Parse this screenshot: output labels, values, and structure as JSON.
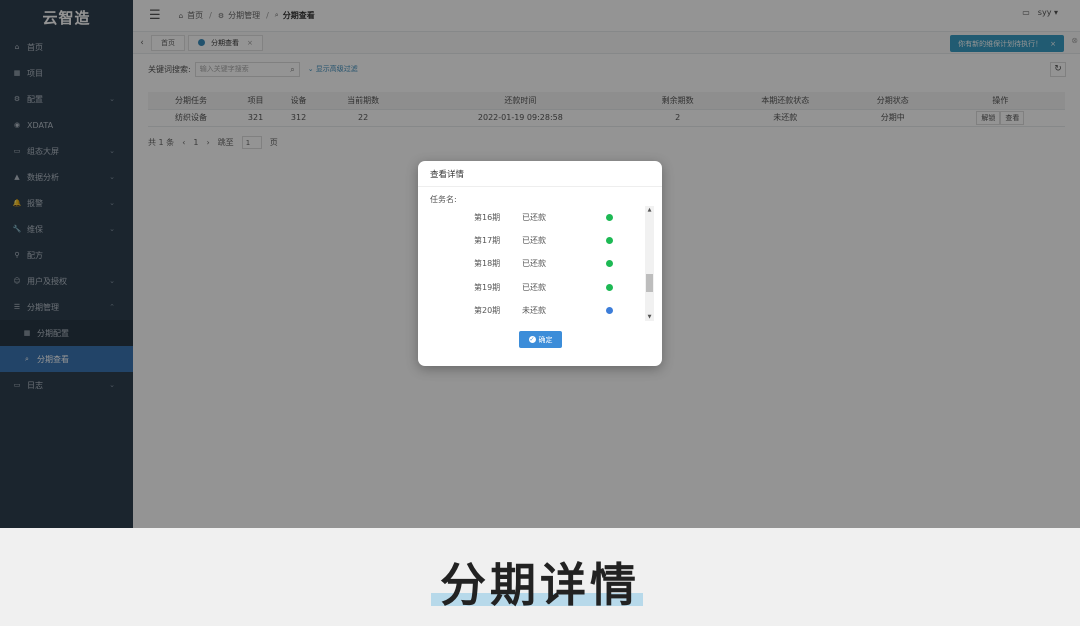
{
  "app": {
    "logo": "云智造"
  },
  "sidebar": {
    "items": [
      {
        "icon": "⌂",
        "label": "首页"
      },
      {
        "icon": "▦",
        "label": "项目"
      },
      {
        "icon": "⚙",
        "label": "配置",
        "chev": "⌄"
      },
      {
        "icon": "◉",
        "label": "XDATA"
      },
      {
        "icon": "▭",
        "label": "组态大屏",
        "chev": "⌄"
      },
      {
        "icon": "▲",
        "label": "数据分析",
        "chev": "⌄"
      },
      {
        "icon": "🔔",
        "label": "报警",
        "chev": "⌄"
      },
      {
        "icon": "🔧",
        "label": "维保",
        "chev": "⌄"
      },
      {
        "icon": "⚲",
        "label": "配方"
      },
      {
        "icon": "☺",
        "label": "用户及授权",
        "chev": "⌄"
      },
      {
        "icon": "☰",
        "label": "分期管理",
        "chev": "⌃"
      },
      {
        "icon": "▦",
        "label": "分期配置"
      },
      {
        "icon": "⌕",
        "label": "分期查看"
      },
      {
        "icon": "▭",
        "label": "日志",
        "chev": "⌄"
      }
    ]
  },
  "topbar": {
    "hamburger": "☰",
    "crumb_home_icon": "⌂",
    "crumb_home": "首页",
    "crumb_mid_icon": "⚙",
    "crumb_mid": "分期管理",
    "crumb_cur_icon": "⌕",
    "crumb_cur": "分期查看",
    "msg_icon": "▭",
    "user": "syy ▾"
  },
  "tabs": {
    "prev": "‹",
    "items": [
      {
        "label": "首页"
      },
      {
        "label": "分期查看",
        "close": "×"
      }
    ]
  },
  "notice": {
    "text": "你有新的维保计划待执行！",
    "close": "×",
    "close_outer": "⊗"
  },
  "toolbar": {
    "search_label": "关键词搜索:",
    "search_placeholder": "输入关键字搜索",
    "search_icon": "⌕",
    "adv": "⌄ 显示高级过滤",
    "refresh": "↻"
  },
  "table": {
    "headers": [
      "分期任务",
      "项目",
      "设备",
      "当前期数",
      "还款时间",
      "剩余期数",
      "本期还款状态",
      "分期状态",
      "操作"
    ],
    "rows": [
      [
        "纺织设备",
        "321",
        "312",
        "22",
        "2022-01-19 09:28:58",
        "2",
        "未还款",
        "分期中",
        [
          "解锁",
          "查看"
        ]
      ]
    ]
  },
  "pager": {
    "total": "共 1 条",
    "prev": "‹",
    "page": "1",
    "next": "›",
    "goto": "跳至",
    "goto_val": "1",
    "unit": "页"
  },
  "modal": {
    "title": "查看详情",
    "task_label": "任务名:",
    "rows": [
      {
        "period": "第16期",
        "status": "已还款",
        "color": "#1db954"
      },
      {
        "period": "第17期",
        "status": "已还款",
        "color": "#1db954"
      },
      {
        "period": "第18期",
        "status": "已还款",
        "color": "#1db954"
      },
      {
        "period": "第19期",
        "status": "已还款",
        "color": "#1db954"
      },
      {
        "period": "第20期",
        "status": "未还款",
        "color": "#3c7dd9"
      }
    ],
    "scroll_up": "▲",
    "scroll_down": "▼",
    "ok": "确定"
  },
  "caption": "分期详情"
}
